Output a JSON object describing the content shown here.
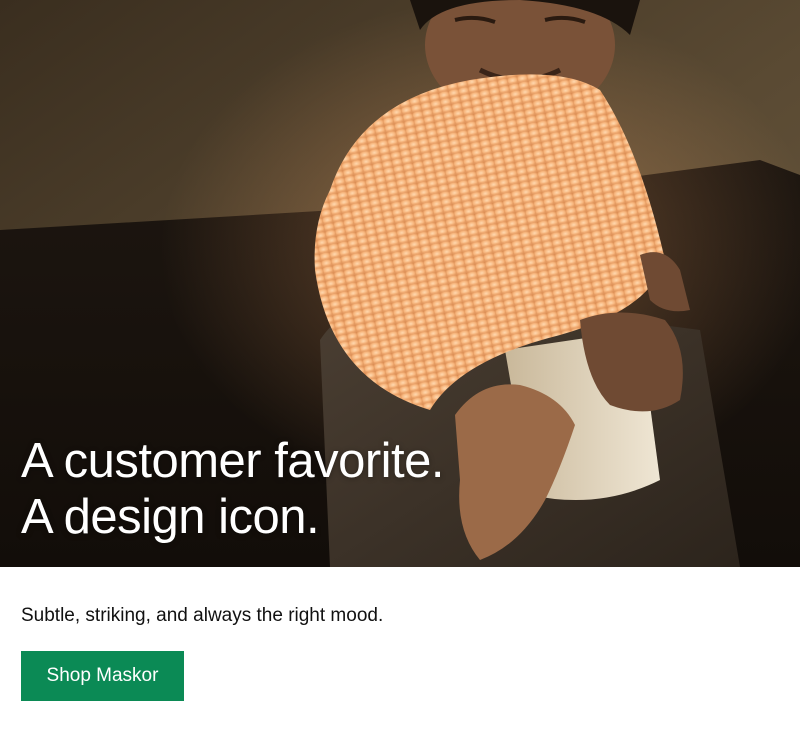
{
  "hero": {
    "image": "man-holding-glowing-lamp",
    "headline_line1": "A customer favorite.",
    "headline_line2": "A design icon."
  },
  "body": {
    "text": "Subtle, striking, and always the right mood."
  },
  "cta": {
    "label": "Shop Maskor",
    "color": "#0b8a55"
  }
}
